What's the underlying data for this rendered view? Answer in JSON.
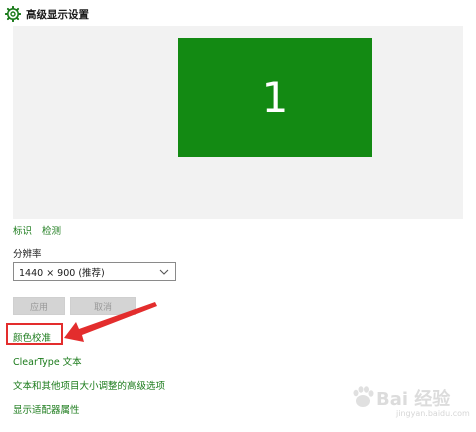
{
  "window": {
    "title": "高级显示设置",
    "icon": "gear-icon"
  },
  "preview": {
    "monitor_number": "1",
    "monitor_color": "#138a13"
  },
  "links": {
    "identify": "标识",
    "detect": "检测"
  },
  "resolution": {
    "label": "分辨率",
    "selected": "1440 × 900 (推荐)"
  },
  "buttons": {
    "apply": "应用",
    "cancel": "取消"
  },
  "related_links": {
    "color_calibration": "颜色校准",
    "cleartype": "ClearType 文本",
    "advanced_sizing": "文本和其他项目大小调整的高级选项",
    "adapter_properties": "显示适配器属性"
  },
  "annotation": {
    "highlight_color": "#e32d2d"
  },
  "watermark": {
    "brand": "Bai  经验",
    "url": "jingyan.baidu.com"
  },
  "colors": {
    "accent": "#1b7b1b",
    "preview_bg": "#f2f2f2"
  }
}
